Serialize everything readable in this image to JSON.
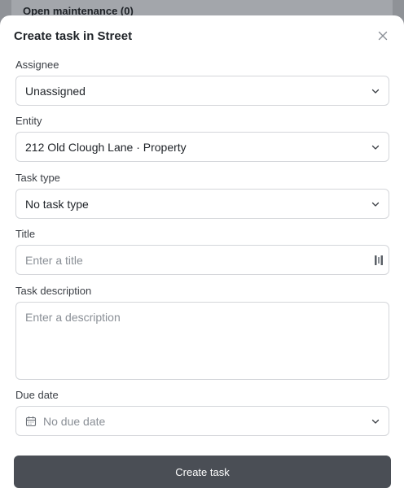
{
  "background": {
    "section_title": "Open maintenance (0)"
  },
  "modal": {
    "title": "Create task in Street",
    "close_icon": "close-icon"
  },
  "fields": {
    "assignee": {
      "label": "Assignee",
      "value": "Unassigned"
    },
    "entity": {
      "label": "Entity",
      "value": "212 Old Clough Lane · Property"
    },
    "task_type": {
      "label": "Task type",
      "value": "No task type"
    },
    "title": {
      "label": "Title",
      "placeholder": "Enter a title"
    },
    "description": {
      "label": "Task description",
      "placeholder": "Enter a description"
    },
    "due_date": {
      "label": "Due date",
      "placeholder": "No due date"
    }
  },
  "actions": {
    "create_label": "Create task"
  },
  "colors": {
    "primary_button": "#4a4e55",
    "border": "#d4d6da",
    "placeholder": "#8a8f96"
  }
}
